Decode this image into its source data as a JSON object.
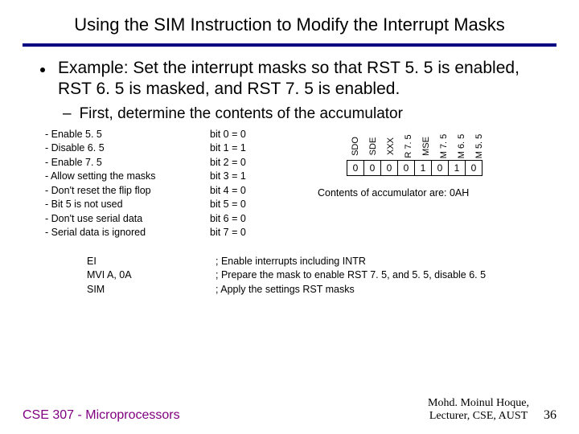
{
  "title": "Using the SIM Instruction to Modify the Interrupt Masks",
  "example": "Example: Set the interrupt masks so that RST 5. 5 is enabled, RST 6. 5 is masked, and RST 7. 5 is enabled.",
  "sub": "First, determine the contents of the accumulator",
  "leftList": [
    "- Enable 5. 5",
    "- Disable 6. 5",
    "- Enable 7. 5",
    "- Allow setting the masks",
    "- Don't reset the flip flop",
    "- Bit 5 is not used",
    "- Don't use serial data",
    "- Serial data is ignored"
  ],
  "bits": [
    "bit 0 = 0",
    "bit 1 = 1",
    "bit 2 = 0",
    "bit 3 = 1",
    "bit 4 = 0",
    "bit 5 = 0",
    "bit 6 = 0",
    "bit 7 = 0"
  ],
  "bitLabels": [
    "SDO",
    "SDE",
    "XXX",
    "R 7. 5",
    "MSE",
    "M 7. 5",
    "M 6. 5",
    "M 5. 5"
  ],
  "bitVals": [
    "0",
    "0",
    "0",
    "0",
    "1",
    "0",
    "1",
    "0"
  ],
  "accCaption": "Contents of accumulator are: 0AH",
  "code": {
    "left": [
      "EI",
      "MVI A, 0A",
      "SIM"
    ],
    "right": [
      "; Enable interrupts including INTR",
      "; Prepare the mask to enable RST 7. 5, and 5. 5, disable 6. 5",
      "; Apply the settings RST masks"
    ]
  },
  "footer": {
    "left": "CSE 307 - Microprocessors",
    "rightLine1": "Mohd. Moinul Hoque,",
    "rightLine2": "Lecturer, CSE, AUST",
    "page": "36"
  }
}
